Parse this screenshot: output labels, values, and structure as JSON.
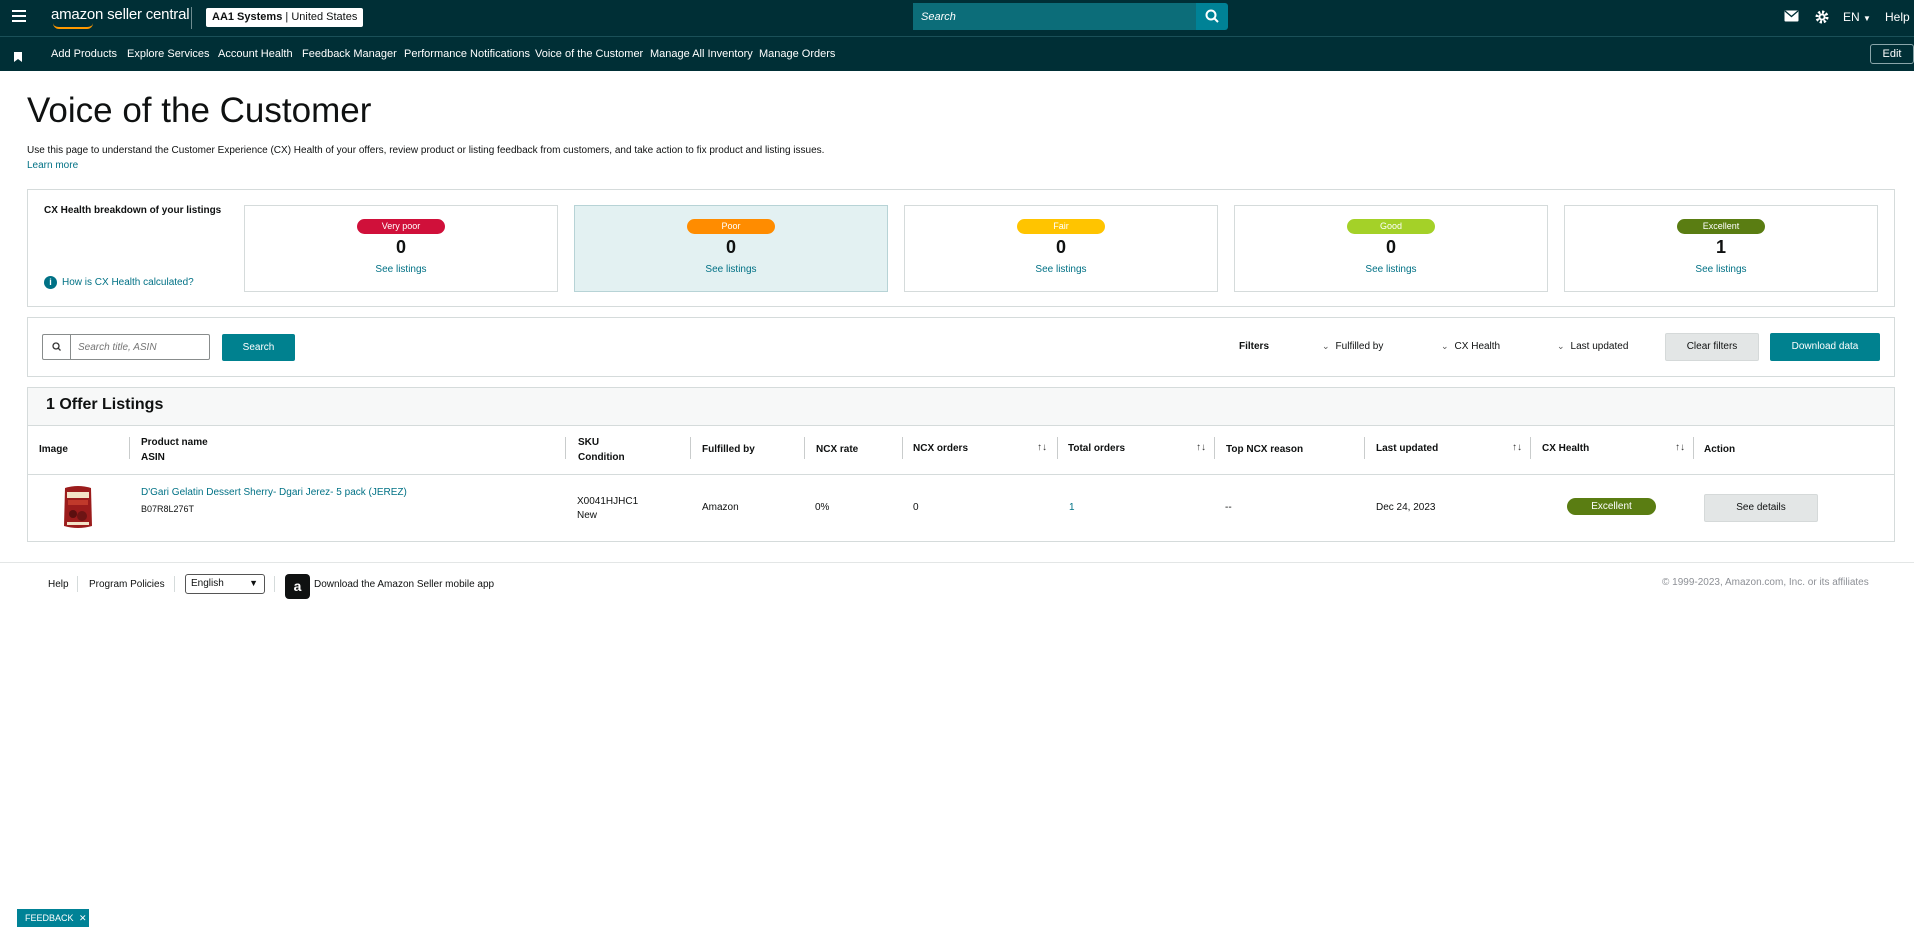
{
  "header": {
    "logo": "amazon seller central",
    "store_name": "AA1 Systems",
    "store_region": "United States",
    "search_placeholder": "Search",
    "lang": "EN",
    "help": "Help"
  },
  "nav": {
    "items": [
      "Add Products",
      "Explore Services",
      "Account Health",
      "Feedback Manager",
      "Performance Notifications",
      "Voice of the Customer",
      "Manage All Inventory",
      "Manage Orders"
    ],
    "edit": "Edit"
  },
  "page": {
    "title": "Voice of the Customer",
    "description": "Use this page to understand the Customer Experience (CX) Health of your offers, review product or listing feedback from customers, and take action to fix product and listing issues.",
    "learn_more": "Learn more"
  },
  "cx": {
    "title": "CX Health breakdown of your listings",
    "how": "How is CX Health calculated?",
    "cards": [
      {
        "label": "Very poor",
        "count": "0",
        "link": "See listings",
        "color": "#d0103a"
      },
      {
        "label": "Poor",
        "count": "0",
        "link": "See listings",
        "color": "#ff8c00"
      },
      {
        "label": "Fair",
        "count": "0",
        "link": "See listings",
        "color": "#ffc400"
      },
      {
        "label": "Good",
        "count": "0",
        "link": "See listings",
        "color": "#a4d128"
      },
      {
        "label": "Excellent",
        "count": "1",
        "link": "See listings",
        "color": "#5a7d12"
      }
    ],
    "selected_index": 1
  },
  "filters": {
    "search_placeholder": "Search title, ASIN",
    "search_button": "Search",
    "filters_label": "Filters",
    "fulfilled_by": "Fulfilled by",
    "cx_health": "CX Health",
    "last_updated": "Last updated",
    "clear": "Clear filters",
    "download": "Download data"
  },
  "listings": {
    "heading": "1 Offer Listings",
    "columns": {
      "image": "Image",
      "product_name": "Product name",
      "asin": "ASIN",
      "sku": "SKU",
      "condition": "Condition",
      "fulfilled_by": "Fulfilled by",
      "ncx_rate": "NCX rate",
      "ncx_orders": "NCX orders",
      "total_orders": "Total orders",
      "top_ncx_reason": "Top NCX reason",
      "last_updated": "Last updated",
      "cx_health": "CX Health",
      "action": "Action"
    },
    "rows": [
      {
        "product_name": "D'Gari Gelatin Dessert Sherry- Dgari Jerez- 5 pack (JEREZ)",
        "asin": "B07R8L276T",
        "sku": "X0041HJHC1",
        "condition": "New",
        "fulfilled_by": "Amazon",
        "ncx_rate": "0%",
        "ncx_orders": "0",
        "total_orders": "1",
        "top_ncx_reason": "--",
        "last_updated": "Dec 24, 2023",
        "cx_health": "Excellent",
        "action": "See details"
      }
    ]
  },
  "footer": {
    "help": "Help",
    "policies": "Program Policies",
    "language": "English",
    "app": "Download the Amazon Seller mobile app",
    "copyright": "© 1999-2023, Amazon.com, Inc. or its affiliates",
    "feedback": "FEEDBACK"
  }
}
